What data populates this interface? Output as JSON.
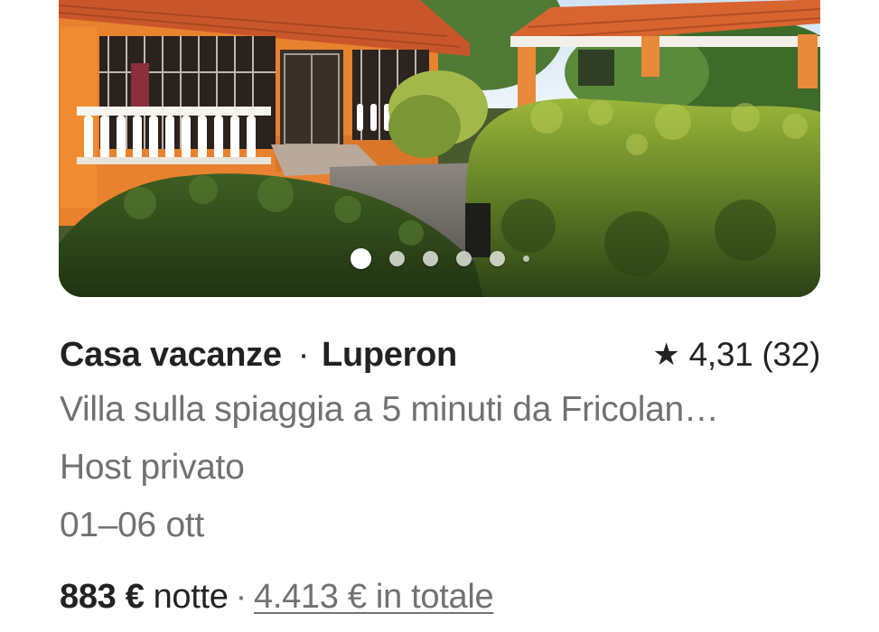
{
  "listing": {
    "photo": {
      "alt": "orange villa with white balustrade and gazebo surrounded by green hedges",
      "dot_count": 6,
      "active_dot_index": 0
    },
    "category": "Casa vacanze",
    "separator": "·",
    "location": "Luperon",
    "rating": {
      "icon": "star-icon",
      "value": "4,31",
      "count": "(32)"
    },
    "description": "Villa sulla spiaggia a 5 minuti da Fricolan…",
    "host_type": "Host privato",
    "dates": "01–06 ott",
    "price": {
      "amount": "883 €",
      "unit": "notte",
      "separator": "·",
      "total": "4.413 € in totale"
    }
  },
  "colors": {
    "primary_text": "#222222",
    "secondary_text": "#717171",
    "house_orange": "#e8822e",
    "roof_terracotta": "#c9562b",
    "foliage": "#4b6b27"
  }
}
